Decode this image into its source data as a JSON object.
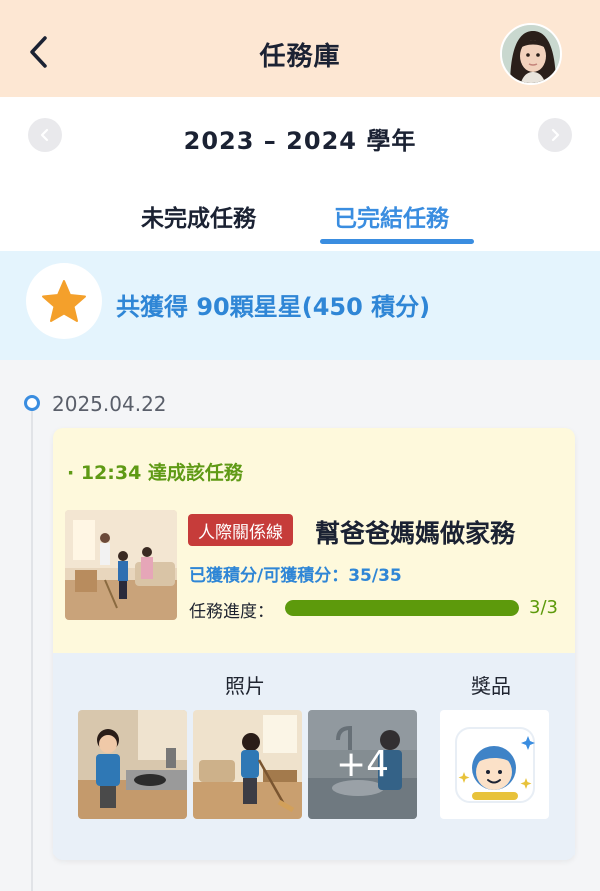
{
  "header": {
    "title": "任務庫",
    "back_icon": "chevron-left-icon",
    "avatar": "user-avatar"
  },
  "year": {
    "label": "2023 – 2024 學年",
    "prev_icon": "chevron-left-icon",
    "next_icon": "chevron-right-icon"
  },
  "tabs": [
    {
      "label": "未完成任務",
      "active": false
    },
    {
      "label": "已完結任務",
      "active": true
    }
  ],
  "summary": {
    "text": "共獲得 90顆星星(450 積分)",
    "icon": "star-icon"
  },
  "timeline": {
    "date": "2025.04.22",
    "card": {
      "completed_at": "· 12:34 達成該任務",
      "category": "人際關係線",
      "title": "幫爸爸媽媽做家務",
      "points_text": "已獲積分/可獲積分：35/35",
      "progress_label": "任務進度：",
      "progress_fraction": 1.0,
      "progress_count": "3/3",
      "photos_title": "照片",
      "prize_title": "獎品",
      "more_photos": "+4"
    }
  },
  "colors": {
    "header_bg": "#fde7d3",
    "accent_blue": "#3a8de0",
    "summary_bg": "#e4f4fd",
    "star": "#f4a02b",
    "badge_red": "#c63c3a",
    "progress_green": "#5d9a0c",
    "card_top_bg": "#fef9dc"
  }
}
